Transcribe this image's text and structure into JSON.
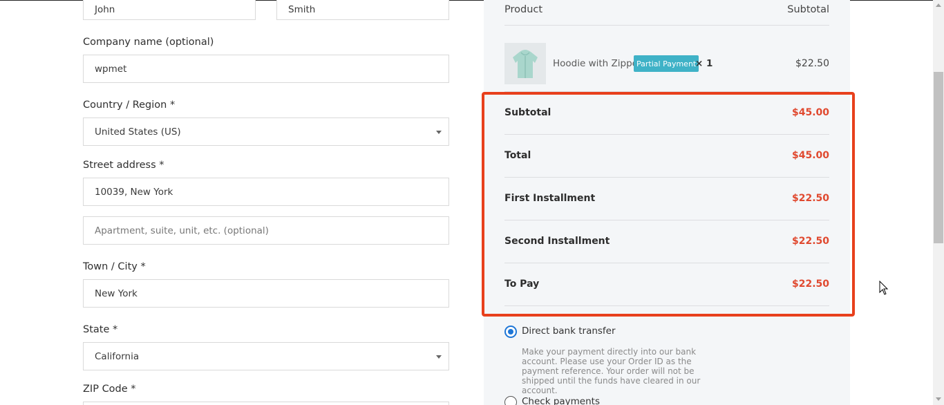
{
  "billing": {
    "first_name": "John",
    "last_name": "Smith",
    "company_label": "Company name (optional)",
    "company_value": "wpmet",
    "country_label": "Country / Region *",
    "country_value": "United States (US)",
    "street_label": "Street address *",
    "street_value": "10039, New York",
    "apartment_placeholder": "Apartment, suite, unit, etc. (optional)",
    "city_label": "Town / City *",
    "city_value": "New York",
    "state_label": "State *",
    "state_value": "California",
    "zip_label": "ZIP Code *"
  },
  "order": {
    "product_header": "Product",
    "subtotal_header": "Subtotal",
    "item": {
      "name": "Hoodie with Zipper",
      "badge": "Partial Payment",
      "qty": "× 1",
      "price": "$22.50"
    },
    "totals": [
      {
        "label": "Subtotal",
        "value": "$45.00"
      },
      {
        "label": "Total",
        "value": "$45.00"
      },
      {
        "label": "First Installment",
        "value": "$22.50"
      },
      {
        "label": "Second Installment",
        "value": "$22.50"
      },
      {
        "label": "To Pay",
        "value": "$22.50"
      }
    ],
    "accent_color": "#e0492f",
    "highlight_color": "#e8401c"
  },
  "payment": {
    "bank_label": "Direct bank transfer",
    "bank_desc": "Make your payment directly into our bank account. Please use your Order ID as the payment reference. Your order will not be shipped until the funds have cleared in our account.",
    "check_label": "Check payments"
  }
}
